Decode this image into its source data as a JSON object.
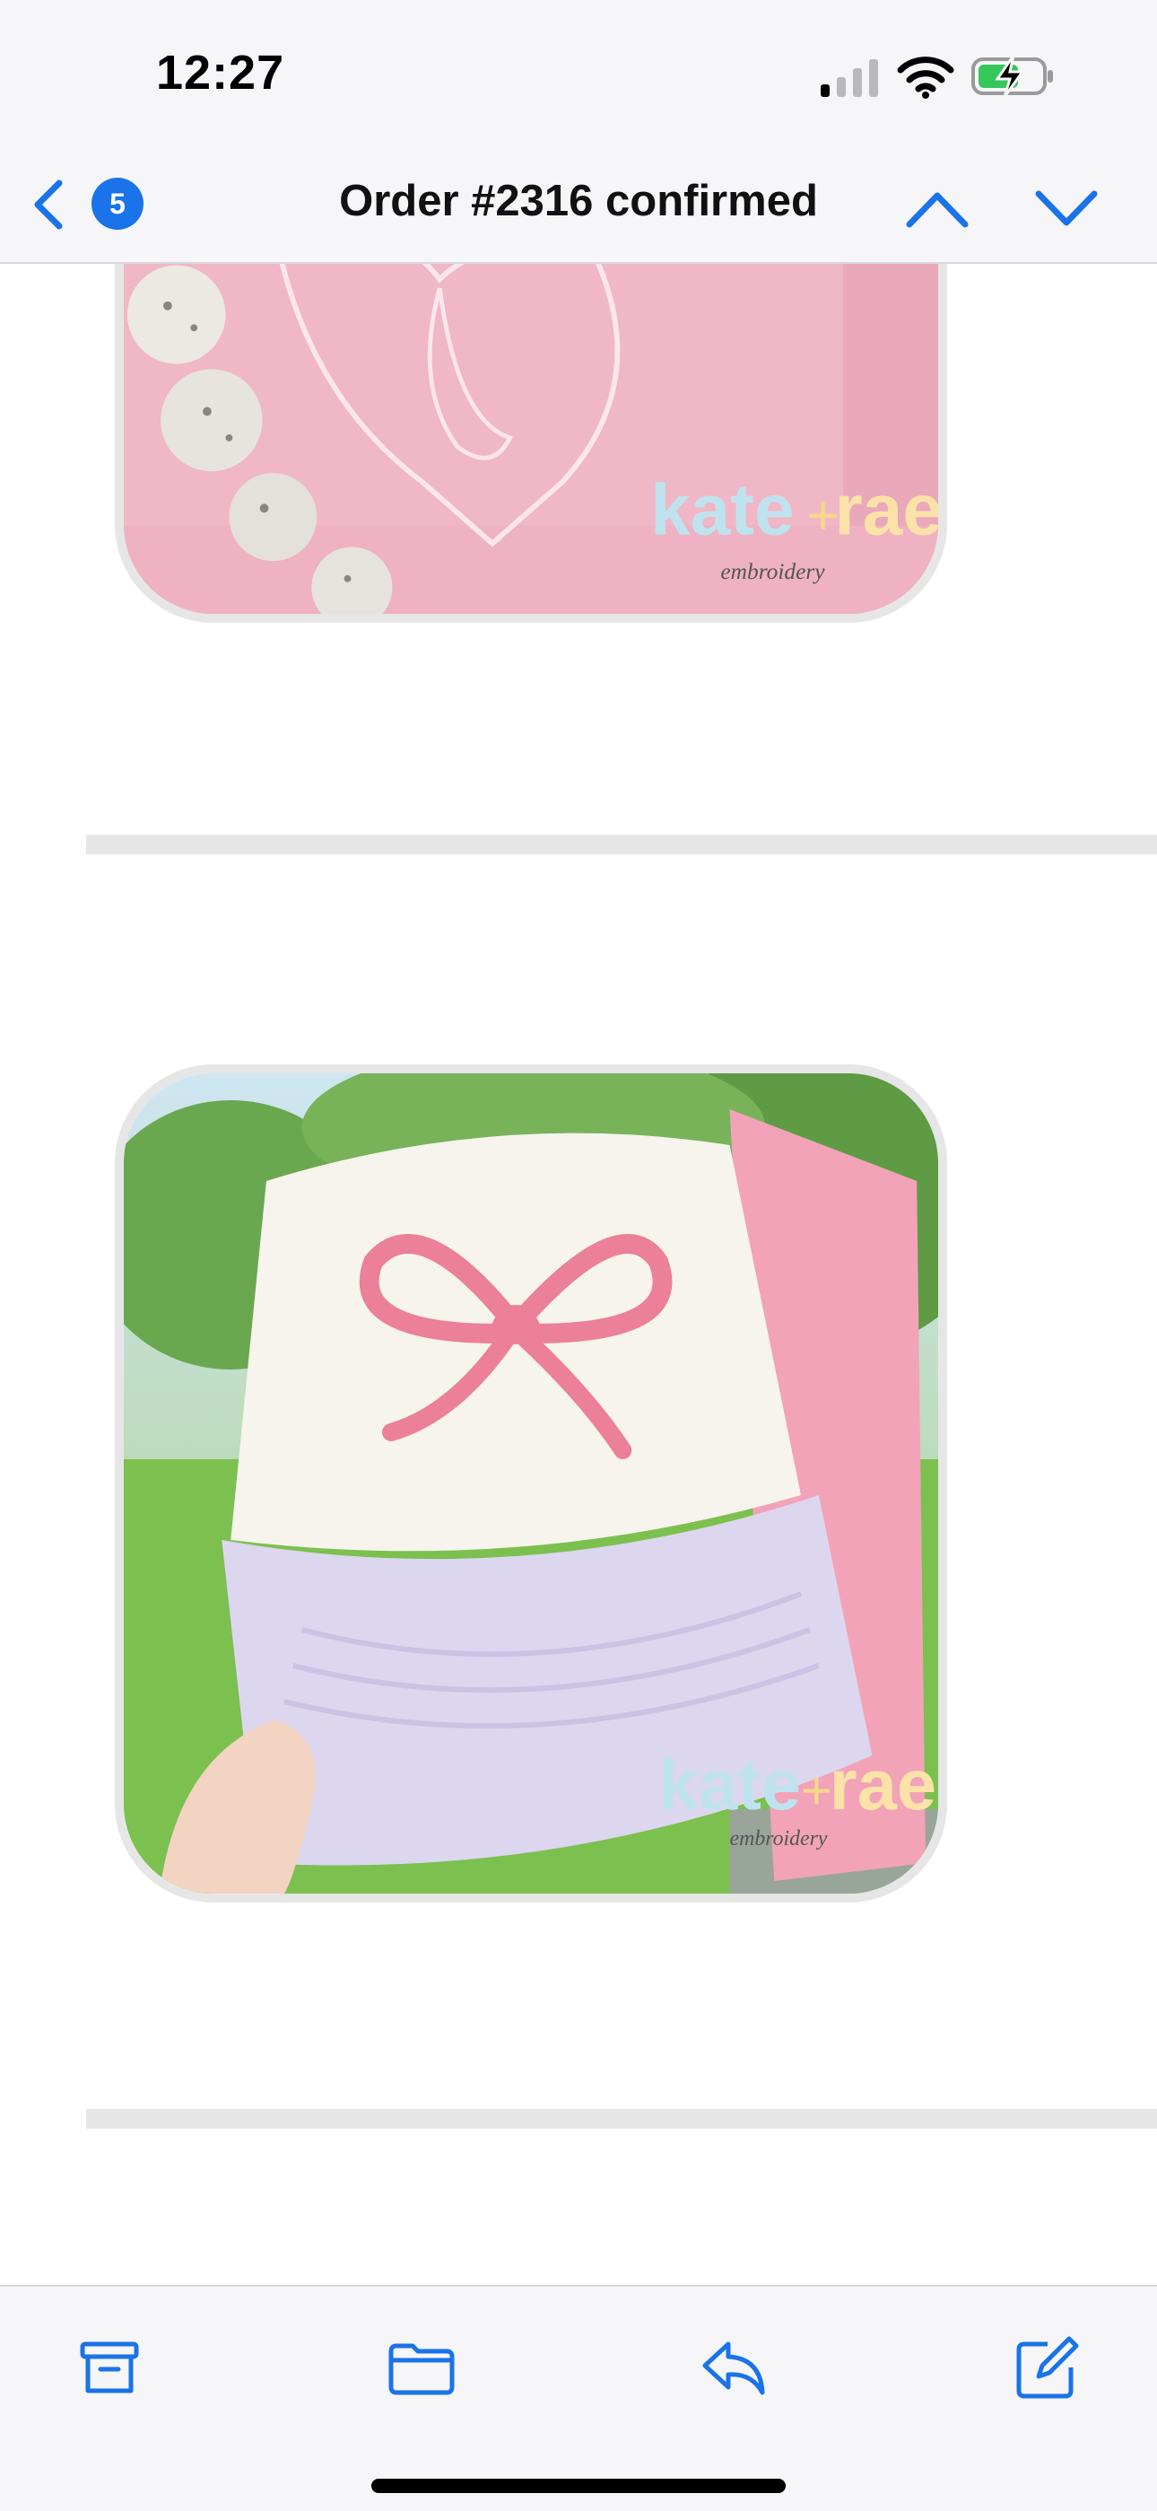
{
  "status_bar": {
    "time": "12:27",
    "signal_icon": "cellular-signal-icon",
    "wifi_icon": "wifi-icon",
    "battery_icon": "battery-charging-icon"
  },
  "nav_bar": {
    "back_icon": "chevron-left-icon",
    "unread_count": "5",
    "title": "Order #2316 confirmed",
    "prev_icon": "chevron-up-icon",
    "next_icon": "chevron-down-icon"
  },
  "products": [
    {
      "image": "pink embroidered sweatshirt with monogram and beads",
      "watermark": "kate+rae embroidery"
    },
    {
      "image": "trucker hat with pink bow embroidery and lavender brim",
      "watermark": "kate+rae embroidery"
    }
  ],
  "toolbar": {
    "archive_icon": "archive-icon",
    "move_icon": "folder-icon",
    "reply_icon": "reply-icon",
    "compose_icon": "compose-icon"
  },
  "colors": {
    "accent": "#1a73e8",
    "bar_background": "#f6f6f8",
    "divider": "#e6e6e6"
  }
}
